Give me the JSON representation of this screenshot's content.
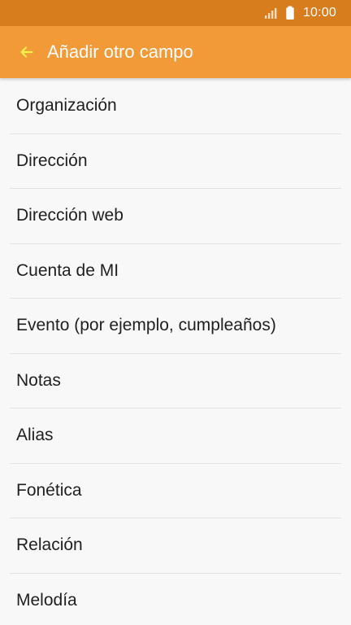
{
  "status_bar": {
    "time": "10:00",
    "icons": [
      "signal-icon",
      "battery-icon"
    ]
  },
  "app_bar": {
    "title": "Añadir otro campo",
    "back_icon": "arrow-left-icon",
    "colors": {
      "status_bar": "#d77d1e",
      "app_bar": "#f29a38",
      "back_icon": "#fff34b"
    }
  },
  "list": {
    "items": [
      {
        "label": "Organización"
      },
      {
        "label": "Dirección"
      },
      {
        "label": "Dirección web"
      },
      {
        "label": "Cuenta de MI"
      },
      {
        "label": "Evento (por ejemplo, cumpleaños)"
      },
      {
        "label": "Notas"
      },
      {
        "label": "Alias"
      },
      {
        "label": "Fonética"
      },
      {
        "label": "Relación"
      },
      {
        "label": "Melodía"
      }
    ]
  }
}
